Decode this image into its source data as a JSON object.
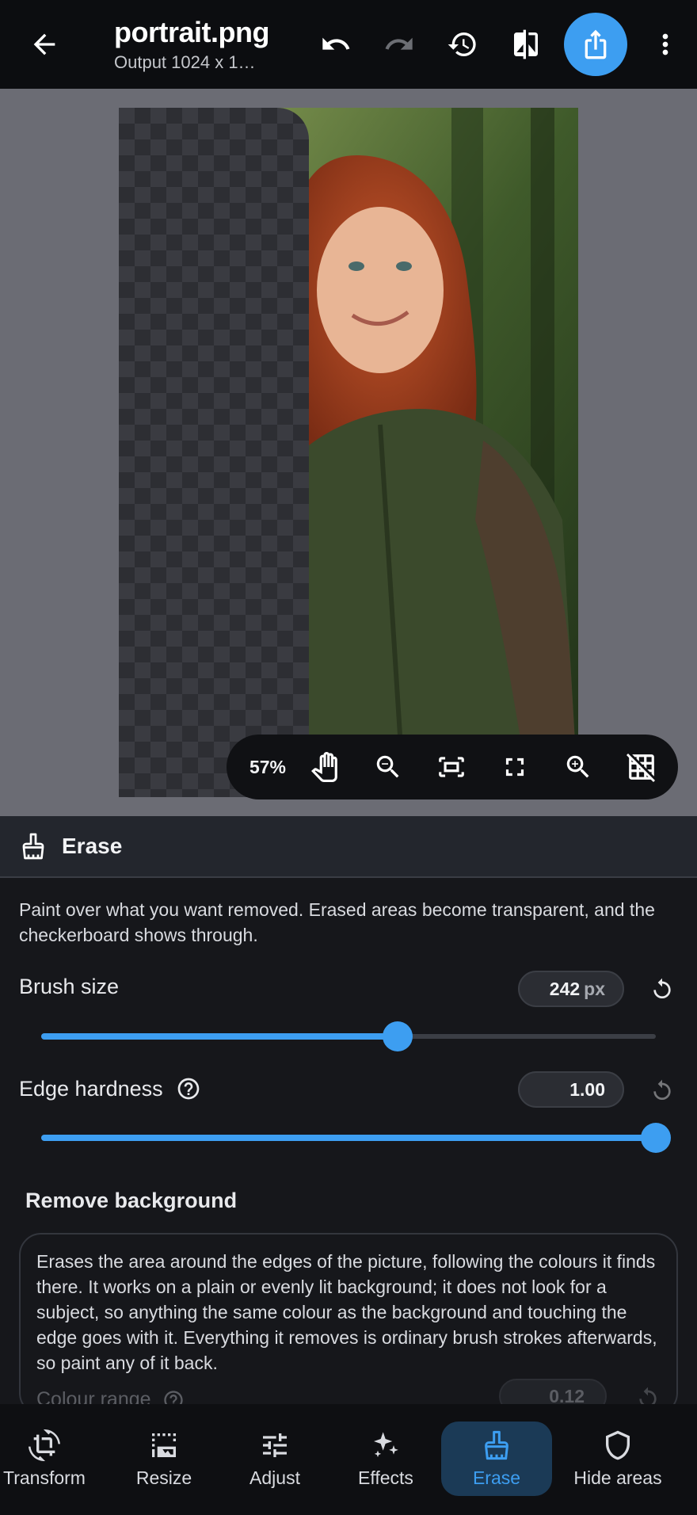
{
  "appbar": {
    "title": "portrait.png",
    "subtitle": "Output 1024 x 1…",
    "icons": [
      "back-arrow-icon",
      "undo-icon",
      "redo-icon",
      "history-icon",
      "compare-icon",
      "share-icon",
      "more-vert-icon"
    ]
  },
  "canvas": {
    "zoom_label": "57%",
    "tools": [
      "pan-hand-icon",
      "zoom-out-icon",
      "fit-screen-icon",
      "fullscreen-icon",
      "zoom-in-icon",
      "grid-off-icon"
    ]
  },
  "panel": {
    "title": "Erase",
    "description": "Paint over what you want removed. Erased areas become transparent, and the checkerboard shows through.",
    "brush_size": {
      "label": "Brush size",
      "value": "242",
      "unit": "px",
      "fraction": 0.58
    },
    "edge_hardness": {
      "label": "Edge hardness",
      "value": "1.00",
      "fraction": 1.0
    },
    "remove_background": {
      "title": "Remove background",
      "description": "Erases the area around the edges of the picture, following the colours it finds there. It works on a plain or evenly lit background; it does not look for a subject, so anything the same colour as the background and touching the edge goes with it. Everything it removes is ordinary brush strokes afterwards, so paint any of it back.",
      "colour_range": {
        "label": "Colour range",
        "value": "0.12"
      }
    }
  },
  "nav": {
    "items": [
      {
        "label": "Transform",
        "icon": "crop-rotate-icon",
        "active": false
      },
      {
        "label": "Resize",
        "icon": "resize-icon",
        "active": false
      },
      {
        "label": "Adjust",
        "icon": "tune-icon",
        "active": false
      },
      {
        "label": "Effects",
        "icon": "sparkle-icon",
        "active": false
      },
      {
        "label": "Erase",
        "icon": "broom-icon",
        "active": true
      },
      {
        "label": "Hide areas",
        "icon": "shield-icon",
        "active": false
      }
    ]
  },
  "colors": {
    "accent": "#3d9ef1",
    "active_nav_bg": "#1b3a56",
    "canvas_bg": "#6b6c74"
  }
}
